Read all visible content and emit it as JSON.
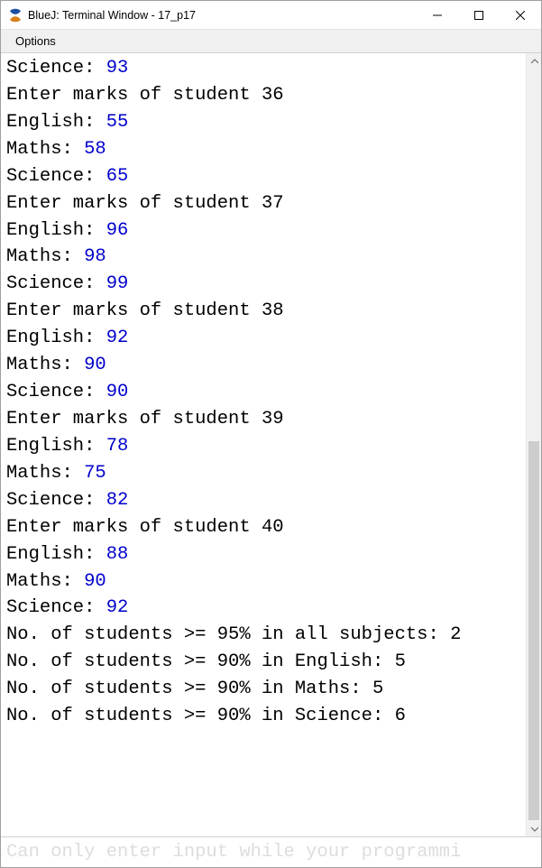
{
  "window": {
    "title": "BlueJ: Terminal Window - 17_p17"
  },
  "menu": {
    "options": "Options"
  },
  "terminal": {
    "lines": [
      {
        "prompt": "Science: ",
        "value": "93"
      },
      {
        "prompt": "Enter marks of student 36",
        "value": null
      },
      {
        "prompt": "English: ",
        "value": "55"
      },
      {
        "prompt": "Maths: ",
        "value": "58"
      },
      {
        "prompt": "Science: ",
        "value": "65"
      },
      {
        "prompt": "Enter marks of student 37",
        "value": null
      },
      {
        "prompt": "English: ",
        "value": "96"
      },
      {
        "prompt": "Maths: ",
        "value": "98"
      },
      {
        "prompt": "Science: ",
        "value": "99"
      },
      {
        "prompt": "Enter marks of student 38",
        "value": null
      },
      {
        "prompt": "English: ",
        "value": "92"
      },
      {
        "prompt": "Maths: ",
        "value": "90"
      },
      {
        "prompt": "Science: ",
        "value": "90"
      },
      {
        "prompt": "Enter marks of student 39",
        "value": null
      },
      {
        "prompt": "English: ",
        "value": "78"
      },
      {
        "prompt": "Maths: ",
        "value": "75"
      },
      {
        "prompt": "Science: ",
        "value": "82"
      },
      {
        "prompt": "Enter marks of student 40",
        "value": null
      },
      {
        "prompt": "English: ",
        "value": "88"
      },
      {
        "prompt": "Maths: ",
        "value": "90"
      },
      {
        "prompt": "Science: ",
        "value": "92"
      },
      {
        "prompt": "No. of students >= 95% in all subjects: 2",
        "value": null
      },
      {
        "prompt": "No. of students >= 90% in English: 5",
        "value": null
      },
      {
        "prompt": "No. of students >= 90% in Maths: 5",
        "value": null
      },
      {
        "prompt": "No. of students >= 90% in Science: 6",
        "value": null
      },
      {
        "prompt": " ",
        "value": null
      },
      {
        "prompt": " ",
        "value": null
      },
      {
        "prompt": " ",
        "value": null
      }
    ]
  },
  "inputbar": {
    "placeholder": "Can only enter input while your programmi"
  }
}
